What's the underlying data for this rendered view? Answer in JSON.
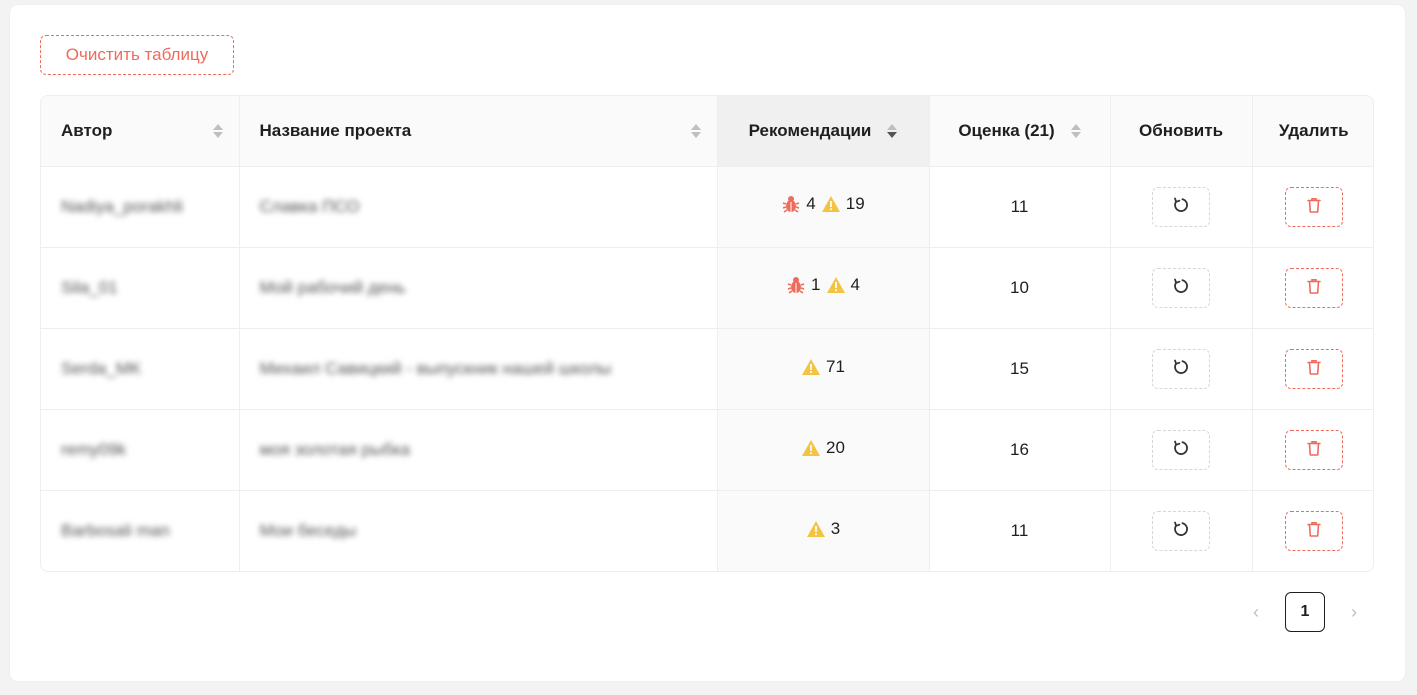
{
  "toolbar": {
    "clear_label": "Очистить таблицу"
  },
  "table": {
    "headers": {
      "author": "Автор",
      "project": "Название проекта",
      "recommendations": "Рекомендации",
      "score": "Оценка (21)",
      "refresh": "Обновить",
      "delete": "Удалить"
    },
    "rows": [
      {
        "author": "Nadiya_porakhli",
        "project": "Славка ПСО",
        "bugs": "4",
        "warnings": "19",
        "score": "11"
      },
      {
        "author": "Sila_01",
        "project": "Мой рабочий день",
        "bugs": "1",
        "warnings": "4",
        "score": "10"
      },
      {
        "author": "Serda_MK",
        "project": "Михаил Савицкий - выпускник нашей школы",
        "bugs": "",
        "warnings": "71",
        "score": "15"
      },
      {
        "author": "remy09k",
        "project": "моя золотая рыбка",
        "bugs": "",
        "warnings": "20",
        "score": "16"
      },
      {
        "author": "Barbosali man",
        "project": "Мои беседы",
        "bugs": "",
        "warnings": "3",
        "score": "11"
      }
    ]
  },
  "pagination": {
    "current": "1",
    "prev_icon": "chevron-left-icon",
    "next_icon": "chevron-right-icon"
  },
  "colors": {
    "accent_danger": "#ef6b5c",
    "warning": "#f5c342",
    "bug": "#ef6b5c"
  }
}
